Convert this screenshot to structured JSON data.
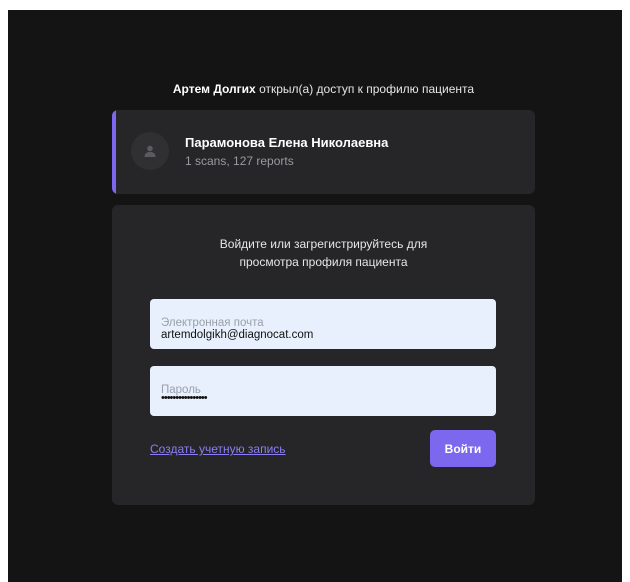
{
  "header": {
    "owner_name": "Артем Долгих",
    "share_text": " открыл(а) доступ к профилю пациента"
  },
  "patient": {
    "name": "Парамонова Елена Николаевна",
    "stats": "1 scans, 127 reports",
    "accent_color": "#7b68ee",
    "avatar_icon": "user-icon"
  },
  "login": {
    "prompt_line1": "Войдите или загрегистрируйтесь для",
    "prompt_line2": "просмотра профиля пациента",
    "email_placeholder": "Электронная почта",
    "email_value": "artemdolgikh@diagnocat.com",
    "password_placeholder": "Пароль",
    "password_mask": "••••••••••••••••",
    "create_account_label": "Создать учетную запись",
    "submit_label": "Войти",
    "button_color": "#7b68ee"
  }
}
